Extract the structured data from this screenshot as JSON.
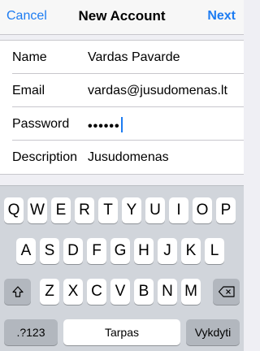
{
  "navbar": {
    "cancel": "Cancel",
    "title": "New Account",
    "next": "Next"
  },
  "form": {
    "rows": [
      {
        "label": "Name",
        "value": "Vardas Pavarde"
      },
      {
        "label": "Email",
        "value": "vardas@jusudomenas.lt"
      },
      {
        "label": "Password",
        "value": "••••••"
      },
      {
        "label": "Description",
        "value": "Jusudomenas"
      }
    ]
  },
  "keyboard": {
    "row1": [
      "Q",
      "W",
      "E",
      "R",
      "T",
      "Y",
      "U",
      "I",
      "O",
      "P"
    ],
    "row2": [
      "A",
      "S",
      "D",
      "F",
      "G",
      "H",
      "J",
      "K",
      "L"
    ],
    "row3": [
      "Z",
      "X",
      "C",
      "V",
      "B",
      "N",
      "M"
    ],
    "numbers_key": ".?123",
    "space_key": "Tarpas",
    "done_key": "Vykdyti",
    "shift_icon": "shift-icon",
    "delete_icon": "delete-icon"
  },
  "colors": {
    "accent": "#1d7cf2",
    "background": "#efeff4",
    "keyboard_bg": "#d1d5db"
  }
}
